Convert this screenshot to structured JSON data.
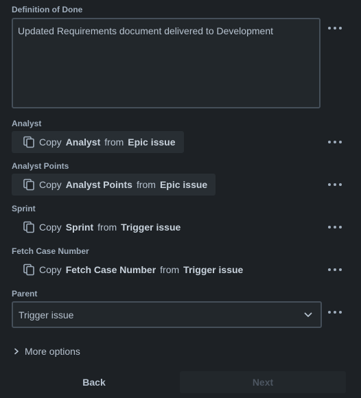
{
  "dod": {
    "label": "Definition of Done",
    "value": "Updated Requirements document delivered to Development"
  },
  "fields": [
    {
      "label": "Analyst",
      "prefix": "Copy",
      "field": "Analyst",
      "middle": "from",
      "source": "Epic issue"
    },
    {
      "label": "Analyst Points",
      "prefix": "Copy",
      "field": "Analyst Points",
      "middle": "from",
      "source": "Epic issue"
    },
    {
      "label": "Sprint",
      "prefix": "Copy",
      "field": "Sprint",
      "middle": "from",
      "source": "Trigger issue"
    },
    {
      "label": "Fetch Case Number",
      "prefix": "Copy",
      "field": "Fetch Case Number",
      "middle": "from",
      "source": "Trigger issue"
    }
  ],
  "parent": {
    "label": "Parent",
    "value": "Trigger issue"
  },
  "more_options": "More options",
  "buttons": {
    "back": "Back",
    "next": "Next"
  },
  "icons": {
    "copy": "copy-icon",
    "more": "more-horizontal-icon",
    "chevron_down": "chevron-down-icon",
    "chevron_right": "chevron-right-icon"
  },
  "colors": {
    "background": "#1d2125",
    "field_background": "#22272b",
    "border": "#454f59",
    "text": "#b6c2cf",
    "muted": "#9fadbc"
  }
}
